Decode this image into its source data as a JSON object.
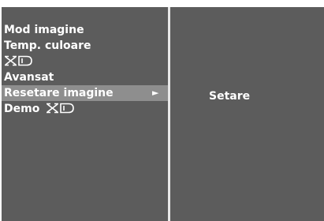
{
  "menu": {
    "items": [
      {
        "label": "Mod imagine",
        "has_logo": false,
        "selected": false
      },
      {
        "label": "Temp. culoare",
        "has_logo": false,
        "selected": false
      },
      {
        "label": "",
        "has_logo": true,
        "logo_text": "XD",
        "selected": false
      },
      {
        "label": "Avansat",
        "has_logo": false,
        "selected": false
      },
      {
        "label": "Resetare imagine",
        "has_logo": false,
        "selected": true,
        "arrow": "►"
      },
      {
        "label": "Demo",
        "has_logo": true,
        "logo_text": "XD",
        "selected": false
      }
    ]
  },
  "submenu": {
    "label": "Setare"
  },
  "colors": {
    "background": "#5c5c5c",
    "selected_highlight": "#8e8e8e",
    "divider": "#e8e8e8",
    "text": "#ffffff"
  }
}
